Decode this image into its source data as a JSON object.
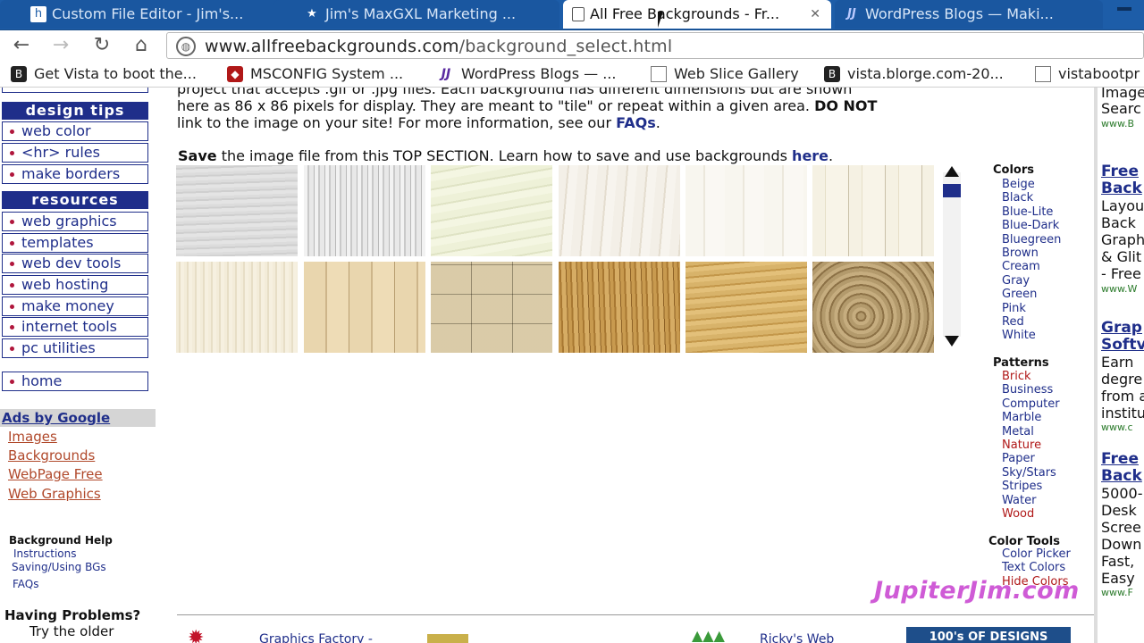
{
  "tabs": [
    {
      "title": "Custom File Editor - Jim's...",
      "icon": "thesis-icon"
    },
    {
      "title": "Jim's MaxGXL Marketing ...",
      "icon": "star-icon"
    },
    {
      "title": "All Free Backgrounds - Fr...",
      "icon": "page-icon",
      "active": true
    },
    {
      "title": "WordPress Blogs — Maki...",
      "icon": "jj-icon"
    }
  ],
  "url": {
    "domain": "www.allfreebackgrounds.com",
    "path": "/background_select.html"
  },
  "bookmarks": [
    {
      "label": "Get Vista to boot the...",
      "icon": "vista-icon"
    },
    {
      "label": "MSCONFIG System ...",
      "icon": "diamond-icon"
    },
    {
      "label": "WordPress Blogs — ...",
      "icon": "jj-icon"
    },
    {
      "label": "Web Slice Gallery",
      "icon": "page-icon"
    },
    {
      "label": "vista.blorge.com-20...",
      "icon": "vista-icon"
    },
    {
      "label": "vistabootpr",
      "icon": "page-icon"
    }
  ],
  "sidebar": {
    "design_tips_head": "design tips",
    "design_tips": [
      "web color",
      "<hr> rules",
      "make borders"
    ],
    "resources_head": "resources",
    "resources": [
      "web graphics",
      "templates",
      "web dev tools",
      "web hosting",
      "make money",
      "internet tools",
      "pc utilities"
    ],
    "home": "home",
    "ads_head": "Ads by Google",
    "ads": [
      "Images",
      "Backgrounds",
      "WebPage Free",
      "Web Graphics"
    ],
    "help_head": "Background Help",
    "help_links": [
      "Instructions",
      "Saving/Using BGs",
      "FAQs"
    ],
    "problems_head": "Having Problems?",
    "problems_text": "Try the older"
  },
  "intro": {
    "line1": "project that accepts .gif or .jpg files. Each background has different dimensions but are shown",
    "line2": "here as 86 x 86 pixels for display. They are meant to \"tile\" or repeat within a given area.",
    "line2_bold": "DO NOT",
    "line3": "link to the image on your site! For more information, see our",
    "line3_link": "FAQs",
    "save_bold": "Save",
    "save_text": "the image file from this TOP SECTION. Learn how to save and use backgrounds",
    "save_link": "here"
  },
  "categories": {
    "colors_head": "Colors",
    "colors": [
      "Beige",
      "Black",
      "Blue-Lite",
      "Blue-Dark",
      "Bluegreen",
      "Brown",
      "Cream",
      "Gray",
      "Green",
      "Pink",
      "Red",
      "White"
    ],
    "patterns_head": "Patterns",
    "patterns": [
      "Brick",
      "Business",
      "Computer",
      "Marble",
      "Metal",
      "Nature",
      "Paper",
      "Sky/Stars",
      "Stripes",
      "Water",
      "Wood"
    ],
    "tools_head": "Color Tools",
    "tools": [
      "Color Picker",
      "Text Colors",
      "Hide Colors"
    ]
  },
  "watermark": "JupiterJim.com",
  "footer": {
    "left": "Graphics Factory -",
    "mid": "Ricky's Web",
    "banner": "100's OF DESIGNS"
  },
  "right_col": {
    "texts": [
      "Image",
      "Searc"
    ],
    "url1": "www.B",
    "block1_title": [
      "Free",
      "Back"
    ],
    "block1_text": [
      "Layou",
      "Back",
      "Graph",
      "& Glit",
      "- Free"
    ],
    "block1_url": "www.W",
    "block2_title": [
      "Grap",
      "Softv"
    ],
    "block2_text": [
      "Earn",
      "degre",
      "from a",
      "institu"
    ],
    "block2_url": "www.c",
    "block3_title": [
      "Free",
      "Back"
    ],
    "block3_text": [
      "5000-",
      "Desk",
      "Scree",
      "Down",
      "Fast,",
      "Easy"
    ],
    "block3_url": "www.F"
  },
  "colors": {
    "tabbar": "#1d5da8",
    "nav": "#1f2e8a",
    "accent": "#b0163c"
  }
}
